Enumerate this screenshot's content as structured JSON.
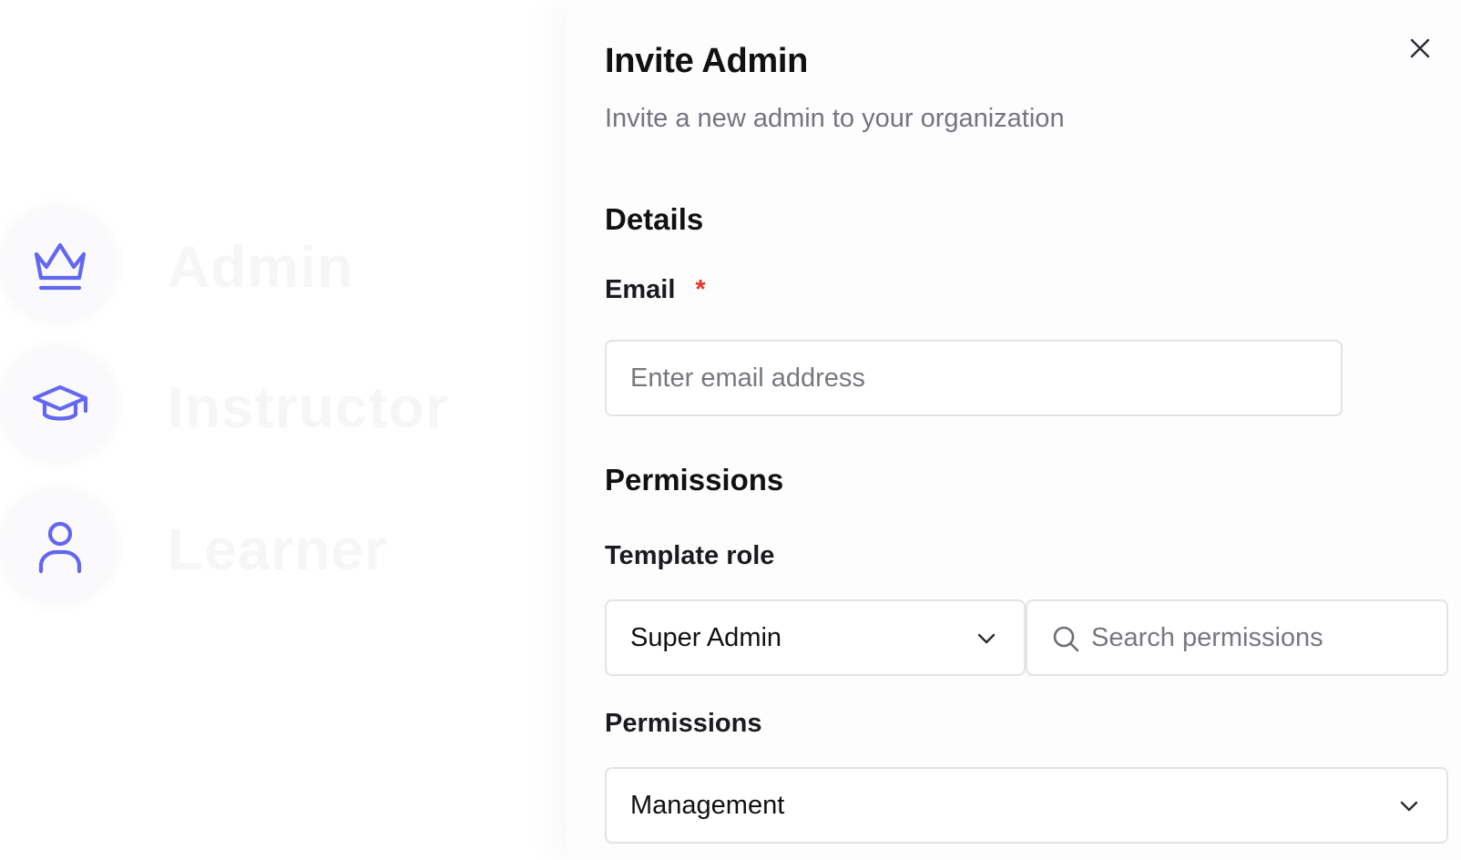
{
  "background": {
    "roles": [
      {
        "icon": "crown-icon",
        "label": "Admin"
      },
      {
        "icon": "graduation-cap-icon",
        "label": "Instructor"
      },
      {
        "icon": "user-icon",
        "label": "Learner"
      }
    ],
    "accent_color": "#6366f1"
  },
  "drawer": {
    "title": "Invite Admin",
    "subtitle": "Invite a new admin to your organization",
    "close_icon": "close-icon",
    "details": {
      "heading": "Details",
      "email_label": "Email",
      "required_marker": "*",
      "email_placeholder": "Enter email address",
      "email_value": ""
    },
    "permissions": {
      "heading": "Permissions",
      "template_role_label": "Template role",
      "template_role_value": "Super Admin",
      "search_placeholder": "Search permissions",
      "search_value": "",
      "permissions_label": "Permissions",
      "permissions_value": "Management"
    }
  }
}
